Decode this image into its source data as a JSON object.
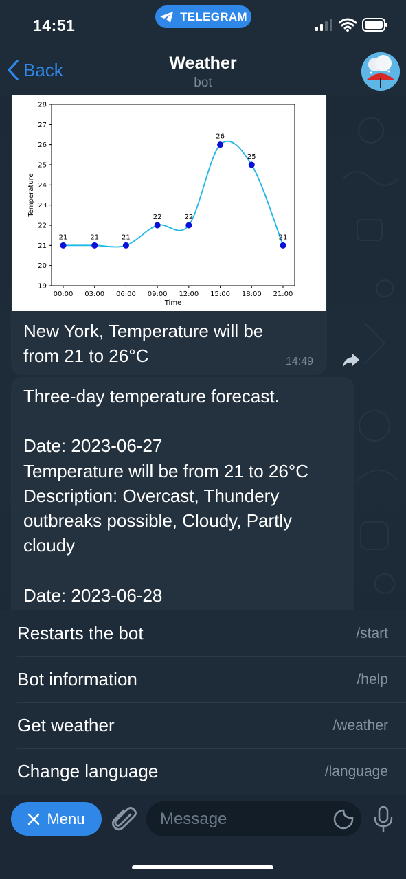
{
  "status_bar": {
    "time": "14:51",
    "app_pill": "TELEGRAM",
    "signal_icon": "cellular-signal-icon",
    "wifi_icon": "wifi-icon",
    "battery_icon": "battery-icon"
  },
  "header": {
    "back_label": "Back",
    "title": "Weather",
    "subtitle": "bot"
  },
  "messages": [
    {
      "type": "image_with_caption",
      "caption_line1": "New York, Temperature will be",
      "caption_line2": "from 21 to 26°C",
      "time": "14:49"
    },
    {
      "type": "text",
      "lines": [
        "Three-day temperature forecast.",
        "",
        "Date: 2023-06-27",
        "Temperature will be from 21 to 26°C",
        "Description: Overcast, Thundery",
        "outbreaks possible, Cloudy, Partly",
        "cloudy",
        "",
        "Date: 2023-06-28"
      ]
    }
  ],
  "chart_data": {
    "type": "line",
    "categories": [
      "00:00",
      "03:00",
      "06:00",
      "09:00",
      "12:00",
      "15:00",
      "18:00",
      "21:00"
    ],
    "values": [
      21,
      21,
      21,
      22,
      22,
      26,
      25,
      21
    ],
    "data_labels": [
      "21",
      "21",
      "21",
      "22",
      "22",
      "26",
      "25",
      "21"
    ],
    "xlabel": "Time",
    "ylabel": "Temperature",
    "ylim": [
      19,
      28
    ],
    "yticks": [
      "19",
      "20",
      "21",
      "22",
      "23",
      "24",
      "25",
      "26",
      "27",
      "28"
    ],
    "line_color": "#1fb8e6",
    "marker_color": "#0a10d8",
    "grid": false,
    "smoothed": true
  },
  "commands": [
    {
      "label": "Restarts the bot",
      "code": "/start"
    },
    {
      "label": "Bot information",
      "code": "/help"
    },
    {
      "label": "Get weather",
      "code": "/weather"
    },
    {
      "label": "Change language",
      "code": "/language"
    }
  ],
  "input": {
    "menu_label": "Menu",
    "placeholder": "Message"
  },
  "colors": {
    "accent": "#2f88e8",
    "bubble": "#24313f",
    "background": "#1b2836"
  }
}
